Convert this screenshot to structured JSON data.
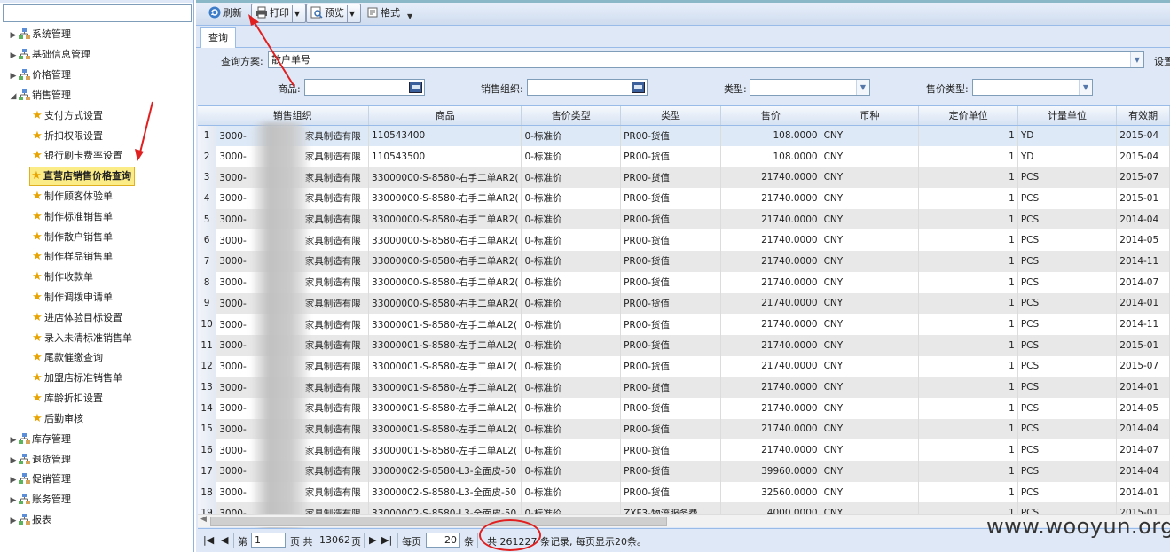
{
  "sidebar": {
    "items": [
      {
        "label": "系统管理",
        "type": "group",
        "expanded": false
      },
      {
        "label": "基础信息管理",
        "type": "group",
        "expanded": false
      },
      {
        "label": "价格管理",
        "type": "group",
        "expanded": false
      },
      {
        "label": "销售管理",
        "type": "group",
        "expanded": true
      },
      {
        "label": "支付方式设置",
        "type": "leaf"
      },
      {
        "label": "折扣权限设置",
        "type": "leaf"
      },
      {
        "label": "银行刷卡费率设置",
        "type": "leaf"
      },
      {
        "label": "直营店销售价格查询",
        "type": "leaf",
        "selected": true
      },
      {
        "label": "制作顾客体验单",
        "type": "leaf"
      },
      {
        "label": "制作标准销售单",
        "type": "leaf"
      },
      {
        "label": "制作散户销售单",
        "type": "leaf"
      },
      {
        "label": "制作样品销售单",
        "type": "leaf"
      },
      {
        "label": "制作收款单",
        "type": "leaf"
      },
      {
        "label": "制作调拨申请单",
        "type": "leaf"
      },
      {
        "label": "进店体验目标设置",
        "type": "leaf"
      },
      {
        "label": "录入未清标准销售单",
        "type": "leaf"
      },
      {
        "label": "尾款催缴查询",
        "type": "leaf"
      },
      {
        "label": "加盟店标准销售单",
        "type": "leaf"
      },
      {
        "label": "库龄折扣设置",
        "type": "leaf"
      },
      {
        "label": "后勤审核",
        "type": "leaf"
      },
      {
        "label": "库存管理",
        "type": "group",
        "expanded": false
      },
      {
        "label": "退货管理",
        "type": "group",
        "expanded": false
      },
      {
        "label": "促销管理",
        "type": "group",
        "expanded": false
      },
      {
        "label": "账务管理",
        "type": "group",
        "expanded": false
      },
      {
        "label": "报表",
        "type": "group",
        "expanded": false
      }
    ]
  },
  "toolbar": {
    "refresh_label": "刷新",
    "print_label": "打印",
    "preview_label": "预览",
    "format_label": "格式"
  },
  "tabs": {
    "query_label": "查询"
  },
  "form": {
    "scheme_label": "查询方案:",
    "scheme_value": "散户单号",
    "settings_label": "设置",
    "product_label": "商品:",
    "sales_org_label": "销售组织:",
    "type_label": "类型:",
    "price_type_label": "售价类型:"
  },
  "grid": {
    "columns": [
      "销售组织",
      "商品",
      "售价类型",
      "类型",
      "售价",
      "币种",
      "定价单位",
      "计量单位",
      "有效期"
    ],
    "rows": [
      {
        "n": "1",
        "org_a": "3000-",
        "org_b": "家具制造有限",
        "product": "110543400",
        "ptype": "0-标准价",
        "type": "PR00-货值",
        "price": "108.0000",
        "cur": "CNY",
        "unit": "1",
        "uom": "YD",
        "valid": "2015-04"
      },
      {
        "n": "2",
        "org_a": "3000-",
        "org_b": "家具制造有限",
        "product": "110543500",
        "ptype": "0-标准价",
        "type": "PR00-货值",
        "price": "108.0000",
        "cur": "CNY",
        "unit": "1",
        "uom": "YD",
        "valid": "2015-04"
      },
      {
        "n": "3",
        "org_a": "3000-",
        "org_b": "家具制造有限",
        "product": "33000000-S-8580-右手二单AR2(",
        "ptype": "0-标准价",
        "type": "PR00-货值",
        "price": "21740.0000",
        "cur": "CNY",
        "unit": "1",
        "uom": "PCS",
        "valid": "2015-07"
      },
      {
        "n": "4",
        "org_a": "3000-",
        "org_b": "家具制造有限",
        "product": "33000000-S-8580-右手二单AR2(",
        "ptype": "0-标准价",
        "type": "PR00-货值",
        "price": "21740.0000",
        "cur": "CNY",
        "unit": "1",
        "uom": "PCS",
        "valid": "2015-01"
      },
      {
        "n": "5",
        "org_a": "3000-",
        "org_b": "家具制造有限",
        "product": "33000000-S-8580-右手二单AR2(",
        "ptype": "0-标准价",
        "type": "PR00-货值",
        "price": "21740.0000",
        "cur": "CNY",
        "unit": "1",
        "uom": "PCS",
        "valid": "2014-04"
      },
      {
        "n": "6",
        "org_a": "3000-",
        "org_b": "家具制造有限",
        "product": "33000000-S-8580-右手二单AR2(",
        "ptype": "0-标准价",
        "type": "PR00-货值",
        "price": "21740.0000",
        "cur": "CNY",
        "unit": "1",
        "uom": "PCS",
        "valid": "2014-05"
      },
      {
        "n": "7",
        "org_a": "3000-",
        "org_b": "家具制造有限",
        "product": "33000000-S-8580-右手二单AR2(",
        "ptype": "0-标准价",
        "type": "PR00-货值",
        "price": "21740.0000",
        "cur": "CNY",
        "unit": "1",
        "uom": "PCS",
        "valid": "2014-11"
      },
      {
        "n": "8",
        "org_a": "3000-",
        "org_b": "家具制造有限",
        "product": "33000000-S-8580-右手二单AR2(",
        "ptype": "0-标准价",
        "type": "PR00-货值",
        "price": "21740.0000",
        "cur": "CNY",
        "unit": "1",
        "uom": "PCS",
        "valid": "2014-07"
      },
      {
        "n": "9",
        "org_a": "3000-",
        "org_b": "家具制造有限",
        "product": "33000000-S-8580-右手二单AR2(",
        "ptype": "0-标准价",
        "type": "PR00-货值",
        "price": "21740.0000",
        "cur": "CNY",
        "unit": "1",
        "uom": "PCS",
        "valid": "2014-01"
      },
      {
        "n": "10",
        "org_a": "3000-",
        "org_b": "家具制造有限",
        "product": "33000001-S-8580-左手二单AL2(",
        "ptype": "0-标准价",
        "type": "PR00-货值",
        "price": "21740.0000",
        "cur": "CNY",
        "unit": "1",
        "uom": "PCS",
        "valid": "2014-11"
      },
      {
        "n": "11",
        "org_a": "3000-",
        "org_b": "家具制造有限",
        "product": "33000001-S-8580-左手二单AL2(",
        "ptype": "0-标准价",
        "type": "PR00-货值",
        "price": "21740.0000",
        "cur": "CNY",
        "unit": "1",
        "uom": "PCS",
        "valid": "2015-01"
      },
      {
        "n": "12",
        "org_a": "3000-",
        "org_b": "家具制造有限",
        "product": "33000001-S-8580-左手二单AL2(",
        "ptype": "0-标准价",
        "type": "PR00-货值",
        "price": "21740.0000",
        "cur": "CNY",
        "unit": "1",
        "uom": "PCS",
        "valid": "2015-07"
      },
      {
        "n": "13",
        "org_a": "3000-",
        "org_b": "家具制造有限",
        "product": "33000001-S-8580-左手二单AL2(",
        "ptype": "0-标准价",
        "type": "PR00-货值",
        "price": "21740.0000",
        "cur": "CNY",
        "unit": "1",
        "uom": "PCS",
        "valid": "2014-01"
      },
      {
        "n": "14",
        "org_a": "3000-",
        "org_b": "家具制造有限",
        "product": "33000001-S-8580-左手二单AL2(",
        "ptype": "0-标准价",
        "type": "PR00-货值",
        "price": "21740.0000",
        "cur": "CNY",
        "unit": "1",
        "uom": "PCS",
        "valid": "2014-05"
      },
      {
        "n": "15",
        "org_a": "3000-",
        "org_b": "家具制造有限",
        "product": "33000001-S-8580-左手二单AL2(",
        "ptype": "0-标准价",
        "type": "PR00-货值",
        "price": "21740.0000",
        "cur": "CNY",
        "unit": "1",
        "uom": "PCS",
        "valid": "2014-04"
      },
      {
        "n": "16",
        "org_a": "3000-",
        "org_b": "家具制造有限",
        "product": "33000001-S-8580-左手二单AL2(",
        "ptype": "0-标准价",
        "type": "PR00-货值",
        "price": "21740.0000",
        "cur": "CNY",
        "unit": "1",
        "uom": "PCS",
        "valid": "2014-07"
      },
      {
        "n": "17",
        "org_a": "3000-",
        "org_b": "家具制造有限",
        "product": "33000002-S-8580-L3-全面皮-50",
        "ptype": "0-标准价",
        "type": "PR00-货值",
        "price": "39960.0000",
        "cur": "CNY",
        "unit": "1",
        "uom": "PCS",
        "valid": "2014-04"
      },
      {
        "n": "18",
        "org_a": "3000-",
        "org_b": "家具制造有限",
        "product": "33000002-S-8580-L3-全面皮-50",
        "ptype": "0-标准价",
        "type": "PR00-货值",
        "price": "32560.0000",
        "cur": "CNY",
        "unit": "1",
        "uom": "PCS",
        "valid": "2014-01"
      },
      {
        "n": "19",
        "org_a": "3000-",
        "org_b": "家具制造有限",
        "product": "33000002-S-8580-L3-全面皮-50",
        "ptype": "0-标准价",
        "type": "ZXF3-物流服务费",
        "price": "4000.0000",
        "cur": "CNY",
        "unit": "1",
        "uom": "PCS",
        "valid": "2015-01"
      }
    ]
  },
  "pager": {
    "page_prefix": "第",
    "page_value": "1",
    "page_suffix": "页 共",
    "total_pages": "13062",
    "page_word": "页",
    "per_page_label": "每页",
    "per_page_value": "20",
    "per_page_unit": "条",
    "summary": "共 261227 条记录, 每页显示20条。"
  },
  "watermark": "www.wooyun.org",
  "colors": {
    "accent": "#99bbe8",
    "panel_bg": "#dfe8f6",
    "annotation": "#e02020",
    "selected_node": "#fbec88"
  }
}
